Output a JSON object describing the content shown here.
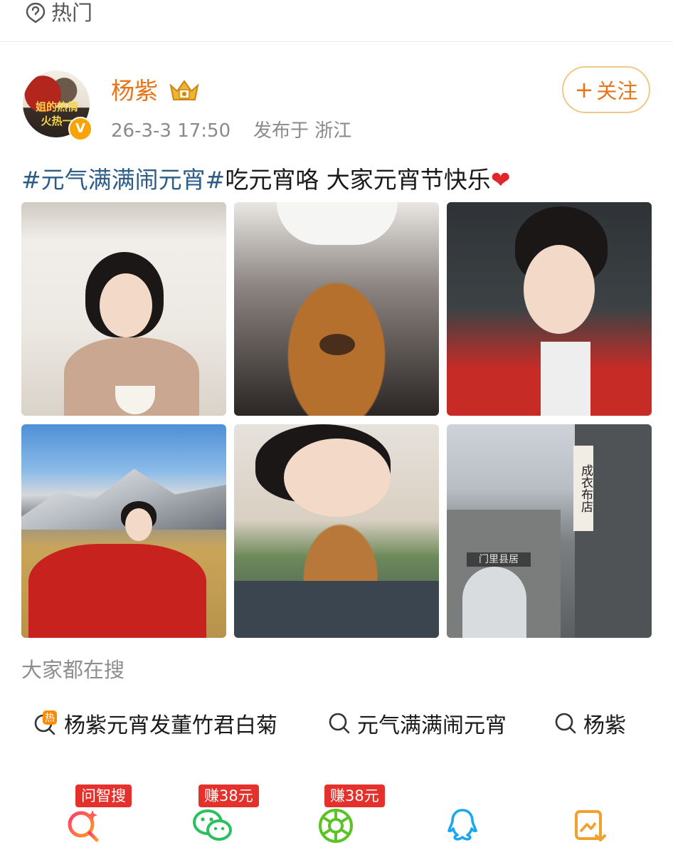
{
  "hot_bar": {
    "label": "热门"
  },
  "post": {
    "username": "杨紫",
    "avatar_text": "姐的热情",
    "avatar_text2": "火热一",
    "verified_mark": "V",
    "time": "26-3-3 17:50",
    "location": "发布于 浙江",
    "follow_label": "关注",
    "follow_plus": "+",
    "text": {
      "topic": "#元气满满闹元宵#",
      "body": "吃元宵咯 大家元宵节快乐",
      "emoji": "❤"
    },
    "images": [
      {
        "name": "photo-1"
      },
      {
        "name": "photo-2"
      },
      {
        "name": "photo-3"
      },
      {
        "name": "photo-4"
      },
      {
        "name": "photo-5"
      },
      {
        "name": "photo-6"
      }
    ],
    "image6_sign": "成衣布店",
    "image6_gate": "门里县居"
  },
  "search": {
    "title": "大家都在搜",
    "items": [
      {
        "label": "杨紫元宵发董竹君白菊",
        "icon": "hot-search-icon",
        "hot_mark": "热"
      },
      {
        "label": "元气满满闹元宵",
        "icon": "search-icon"
      },
      {
        "label": "杨紫",
        "icon": "search-icon"
      }
    ]
  },
  "share_bar": {
    "badges": [
      "问智搜",
      "赚38元",
      "赚38元"
    ],
    "icons": [
      "ai-search-icon",
      "wechat-icon",
      "moments-icon",
      "qq-icon",
      "save-image-icon"
    ]
  },
  "colors": {
    "accent_orange": "#e8751a",
    "topic_blue": "#2d5d86",
    "badge_red": "#e4312b"
  }
}
